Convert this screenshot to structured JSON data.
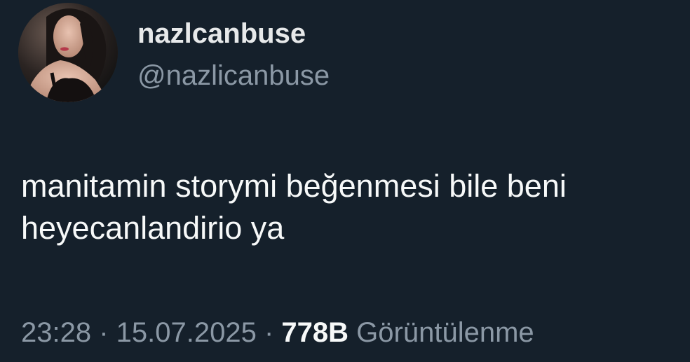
{
  "author": {
    "display_name": "nazlcanbuse",
    "handle": "@nazlicanbuse",
    "avatar_icon": "profile-photo"
  },
  "tweet": {
    "lines": [
      "manitamin storymi beğenmesi bile beni",
      "heyecanlandirio ya"
    ]
  },
  "meta": {
    "time": "23:28",
    "separator": " · ",
    "date": "15.07.2025",
    "views_count": "778B",
    "views_label": "Görüntülenme"
  },
  "colors": {
    "background": "#15202b",
    "primary_text": "#f7f9f9",
    "secondary_text": "#8b98a5"
  }
}
